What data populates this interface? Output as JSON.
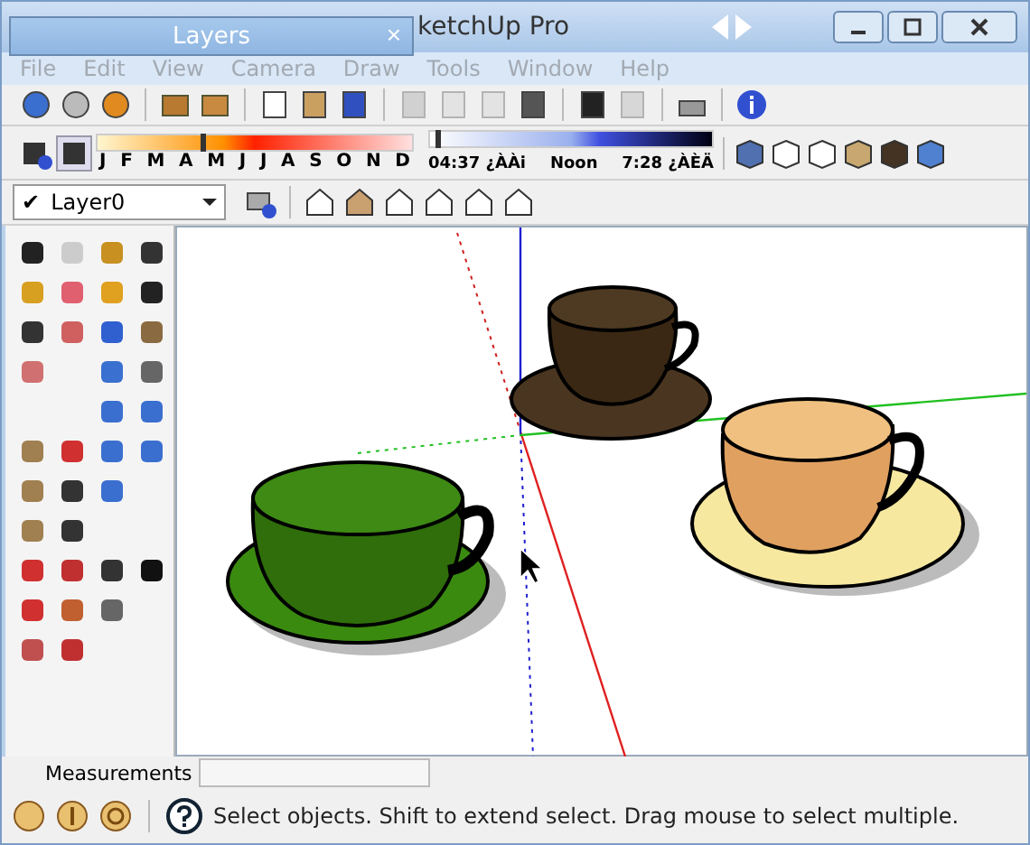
{
  "window": {
    "title": "ketchUp Pro"
  },
  "layers_panel": {
    "title": "Layers",
    "close": "×"
  },
  "menu": [
    {
      "label": "File",
      "disabled": true
    },
    {
      "label": "Edit",
      "disabled": true
    },
    {
      "label": "View",
      "disabled": true
    },
    {
      "label": "Camera",
      "disabled": true
    },
    {
      "label": "Draw",
      "disabled": true
    },
    {
      "label": "Tools",
      "disabled": true
    },
    {
      "label": "Window",
      "disabled": true
    },
    {
      "label": "Help",
      "disabled": true
    }
  ],
  "standard_toolbar": [
    {
      "disabled": false
    },
    {
      "disabled": false
    },
    {
      "disabled": false
    },
    {
      "disabled": true
    },
    {
      "disabled": true
    },
    {
      "disabled": true
    },
    {
      "disabled": false
    },
    {
      "disabled": false
    },
    {
      "disabled": true
    },
    {
      "disabled": false
    }
  ],
  "shadows": {
    "months": [
      "J",
      "F",
      "M",
      "A",
      "M",
      "J",
      "J",
      "A",
      "S",
      "O",
      "N",
      "D"
    ],
    "time_start": "04:37 ¿ÀÀi",
    "time_noon": "Noon",
    "time_end": "7:28 ¿ÀÈÄ",
    "date_slider": {
      "level": 0.33
    },
    "time_slider": {
      "level": 0.02
    }
  },
  "layer_select": {
    "check": "✔",
    "value": "Layer0"
  },
  "measurements": {
    "label": "Measurements"
  },
  "status_bar": {
    "text": "Select objects. Shift to extend select. Drag mouse to select multiple."
  }
}
